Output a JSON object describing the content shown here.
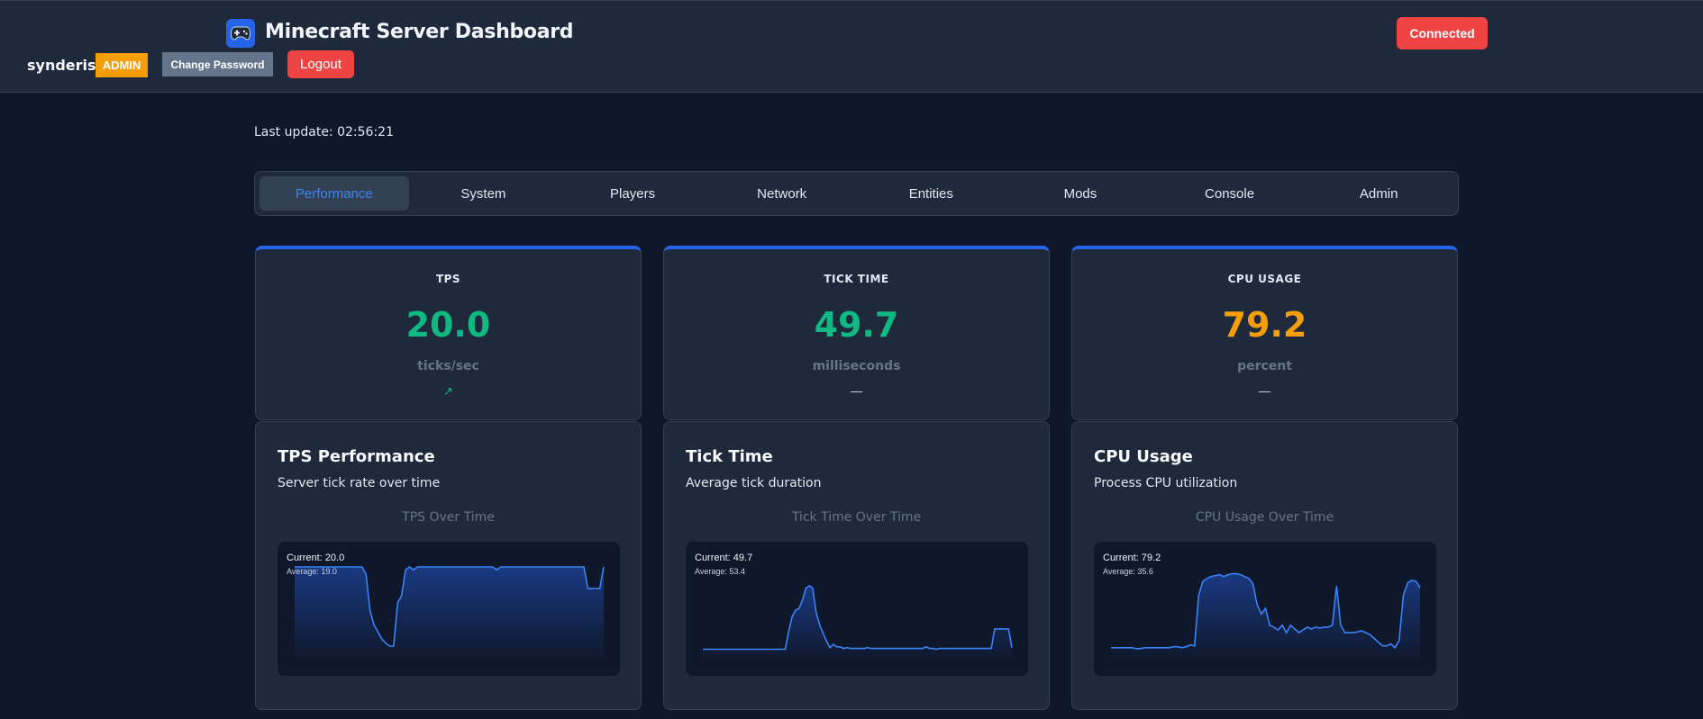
{
  "header": {
    "title": "Minecraft Server Dashboard",
    "logo_icon": "gamepad-icon",
    "username": "synderis",
    "role_badge": "ADMIN",
    "change_password_label": "Change Password",
    "logout_label": "Logout",
    "connection_status": "Connected"
  },
  "last_update": "Last update: 02:56:21",
  "tabs": [
    {
      "label": "Performance",
      "active": true
    },
    {
      "label": "System"
    },
    {
      "label": "Players"
    },
    {
      "label": "Network"
    },
    {
      "label": "Entities"
    },
    {
      "label": "Mods"
    },
    {
      "label": "Console"
    },
    {
      "label": "Admin"
    }
  ],
  "colors": {
    "accent": "#2563eb",
    "good": "#10b981",
    "warn": "#f59e0b",
    "danger": "#ef4444",
    "line": "#3b82f6"
  },
  "stats": [
    {
      "label": "TPS",
      "value": "20.0",
      "unit": "ticks/sec",
      "trend": "↗",
      "color": "#10b981",
      "trend_color": "#10b981"
    },
    {
      "label": "TICK TIME",
      "value": "49.7",
      "unit": "milliseconds",
      "trend": "—",
      "color": "#10b981",
      "trend_color": "#e2e8f0"
    },
    {
      "label": "CPU USAGE",
      "value": "79.2",
      "unit": "percent",
      "trend": "—",
      "color": "#f59e0b",
      "trend_color": "#e2e8f0"
    }
  ],
  "charts": [
    {
      "title": "TPS Performance",
      "subtitle": "Server tick rate over time",
      "caption": "TPS Over Time",
      "current": "Current: 20.0",
      "average": "Average: 19.0"
    },
    {
      "title": "Tick Time",
      "subtitle": "Average tick duration",
      "caption": "Tick Time Over Time",
      "current": "Current: 49.7",
      "average": "Average: 53.4"
    },
    {
      "title": "CPU Usage",
      "subtitle": "Process CPU utilization",
      "caption": "CPU Usage Over Time",
      "current": "Current: 79.2",
      "average": "Average: 35.6"
    }
  ],
  "chart_data": [
    {
      "type": "area",
      "title": "TPS Over Time",
      "ylim": [
        14,
        20.5
      ],
      "series": [
        {
          "values": [
            20,
            20,
            20,
            20,
            20,
            20,
            20,
            20,
            20,
            20,
            20,
            20,
            20,
            20,
            20,
            20,
            20,
            20,
            19.5,
            17,
            16,
            15.5,
            15,
            14.7,
            14.5,
            14.5,
            17.5,
            18,
            19.8,
            20,
            19.8,
            20,
            20,
            20,
            20,
            20,
            20,
            20,
            20,
            20,
            20,
            20,
            20,
            20,
            20,
            20,
            20,
            20,
            20,
            20,
            20,
            19.8,
            20,
            20,
            20,
            20,
            20,
            20,
            20,
            20,
            20,
            20,
            20,
            20,
            20,
            20,
            20,
            20,
            20,
            20,
            20,
            20,
            20,
            20,
            18.5,
            18.5,
            18.5,
            18.5,
            20
          ]
        }
      ]
    },
    {
      "type": "area",
      "title": "Tick Time Over Time",
      "ylim": [
        45,
        160
      ],
      "series": [
        {
          "values": [
            50,
            50,
            50,
            50,
            50,
            50,
            50,
            50,
            50,
            50,
            50,
            50,
            50,
            50,
            50,
            50,
            50,
            50,
            50,
            50,
            50,
            50,
            50,
            50,
            50,
            72,
            90,
            98,
            100,
            110,
            125,
            128,
            125,
            95,
            80,
            70,
            60,
            52,
            56,
            53,
            53,
            51,
            52,
            51,
            51,
            51,
            51,
            51,
            52,
            51,
            51,
            51,
            51,
            51,
            51,
            51,
            51,
            51,
            51,
            51,
            51,
            51,
            51,
            51,
            51,
            53,
            51,
            51,
            50,
            51,
            51,
            51,
            51,
            51,
            51,
            51,
            51,
            51,
            51,
            51,
            51,
            51,
            51,
            51,
            51,
            75,
            75,
            75,
            75,
            75,
            52
          ]
        }
      ]
    },
    {
      "type": "area",
      "title": "CPU Usage Over Time",
      "ylim": [
        0,
        100
      ],
      "series": [
        {
          "values": [
            6,
            6,
            6,
            6,
            6,
            6,
            5,
            5,
            6,
            6,
            6,
            6,
            6,
            6,
            6,
            7,
            7,
            6,
            7,
            9,
            8,
            62,
            77,
            80,
            82,
            83,
            84,
            82,
            84,
            85,
            85,
            84,
            82,
            80,
            74,
            52,
            42,
            48,
            30,
            28,
            25,
            30,
            22,
            30,
            26,
            22,
            25,
            28,
            26,
            28,
            27,
            28,
            28,
            30,
            72,
            30,
            22,
            22,
            22,
            23,
            24,
            22,
            20,
            16,
            12,
            8,
            8,
            10,
            6,
            14,
            62,
            75,
            78,
            77,
            70
          ]
        }
      ]
    }
  ]
}
